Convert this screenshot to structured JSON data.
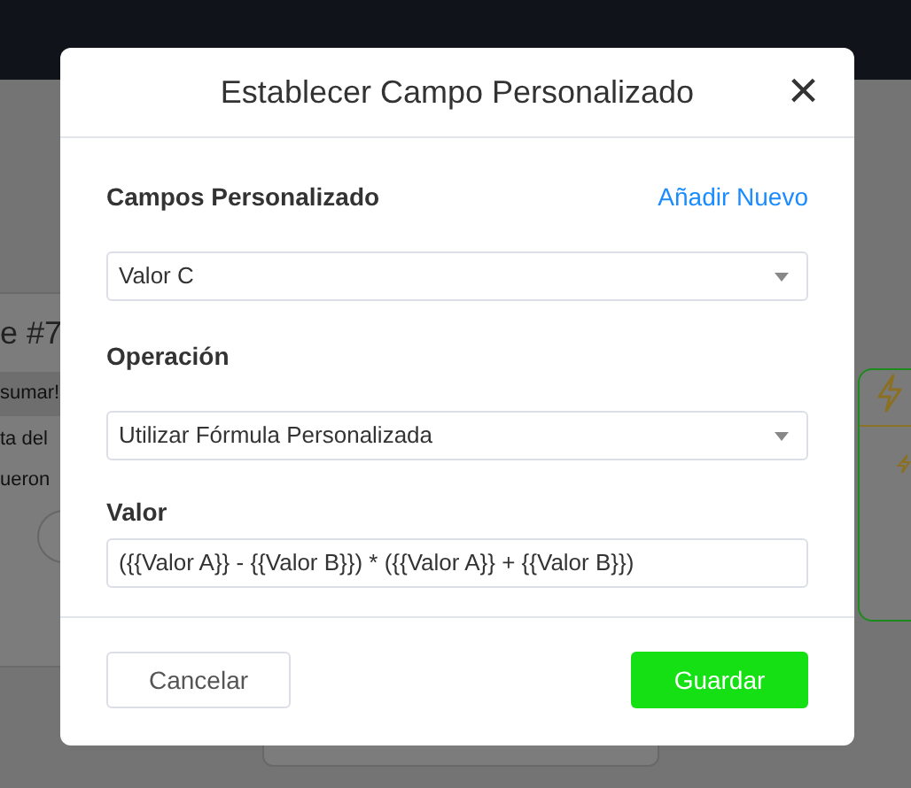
{
  "background": {
    "left_card": {
      "title": "e #7",
      "banner": "sumar!",
      "lines": [
        "ta del",
        "ueron"
      ]
    }
  },
  "dialog": {
    "title": "Establecer Campo Personalizado",
    "close": "×",
    "fields": [
      {
        "kind": "select",
        "label": "Campos Personalizado",
        "link": "Añadir Nuevo",
        "value": "Valor C"
      },
      {
        "kind": "select",
        "label": "Operación",
        "value": "Utilizar Fórmula Personalizada"
      },
      {
        "kind": "text",
        "label": "Valor",
        "value": "({{Valor A}} - {{Valor B}}) * ({{Valor A}} + {{Valor B}})"
      }
    ],
    "buttons": [
      {
        "label": "Cancelar",
        "kind": "secondary"
      },
      {
        "label": "Guardar",
        "kind": "primary"
      }
    ]
  }
}
